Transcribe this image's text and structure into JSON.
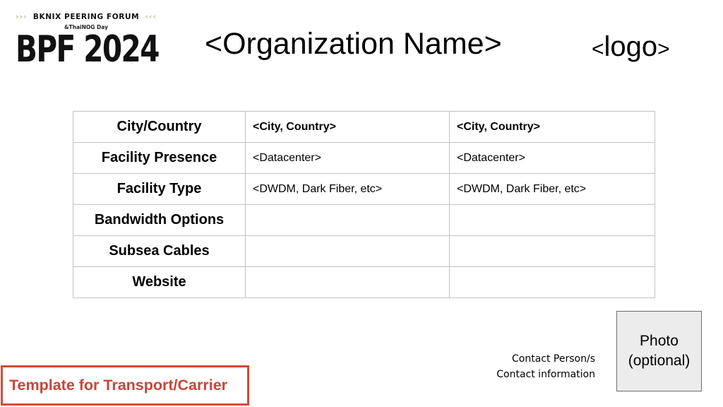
{
  "event_logo": {
    "tagline": "BKNIX PEERING FORUM",
    "left_chevrons": "›››",
    "right_chevrons": "‹‹‹",
    "subtitle": "&ThaiNOG Day",
    "title": "BPF 2024",
    "chevron_color": "#b6c6a0"
  },
  "header": {
    "organization_name": "<Organization Name>",
    "logo_placeholder_open": "<",
    "logo_placeholder_text": "logo",
    "logo_placeholder_close": ">"
  },
  "table": {
    "rows": [
      {
        "label": "City/Country",
        "col1": "<City, Country>",
        "col2": "<City, Country>"
      },
      {
        "label": "Facility Presence",
        "col1": "<Datacenter>",
        "col2": "<Datacenter>"
      },
      {
        "label": "Facility Type",
        "col1": "<DWDM, Dark Fiber, etc>",
        "col2": "<DWDM, Dark Fiber, etc>"
      },
      {
        "label": "Bandwidth Options",
        "col1": "",
        "col2": ""
      },
      {
        "label": "Subsea Cables",
        "col1": "",
        "col2": ""
      },
      {
        "label": "Website",
        "col1": "",
        "col2": ""
      }
    ]
  },
  "contact": {
    "line1": "Contact Person/s",
    "line2": "Contact information"
  },
  "photo": {
    "line1": "Photo",
    "line2": "(optional)"
  },
  "template_label": {
    "text": "Template for Transport/Carrier",
    "color": "#d24a3c"
  }
}
